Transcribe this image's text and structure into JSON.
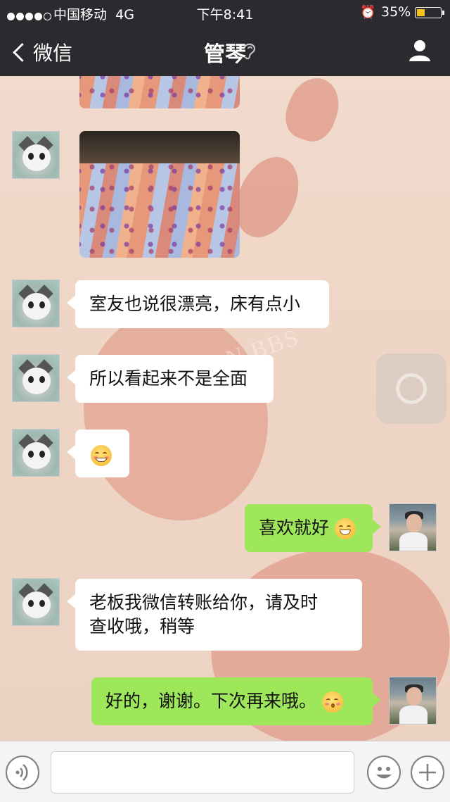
{
  "status_bar": {
    "carrier": "中国移动",
    "network": "4G",
    "time": "下午8:41",
    "battery_percent": "35%",
    "battery_level": 0.35,
    "icons": [
      "signal-dots-icon",
      "alarm-icon",
      "battery-icon"
    ]
  },
  "nav": {
    "back_label": "微信",
    "title": "管琴",
    "icons": [
      "chevron-left-icon",
      "earpiece-icon",
      "person-icon"
    ]
  },
  "messages": [
    {
      "id": "m1",
      "from": "contact",
      "type": "image",
      "content": "quilt photo (partial)"
    },
    {
      "id": "m2",
      "from": "contact",
      "type": "image",
      "content": "quilt photo"
    },
    {
      "id": "m3",
      "from": "contact",
      "type": "text",
      "text": "室友也说很漂亮，床有点小"
    },
    {
      "id": "m4",
      "from": "contact",
      "type": "text",
      "text": "所以看起来不是全面"
    },
    {
      "id": "m5",
      "from": "contact",
      "type": "emoji",
      "emoji": "blushing-smile-emoji"
    },
    {
      "id": "m6",
      "from": "me",
      "type": "text",
      "text": "喜欢就好",
      "emoji": "grinning-emoji"
    },
    {
      "id": "m7",
      "from": "contact",
      "type": "text",
      "text": "老板我微信转账给你，请及时",
      "text2": "查收哦，稍等"
    },
    {
      "id": "m8",
      "from": "me",
      "type": "text",
      "text": "好的，谢谢。下次再来哦。",
      "emoji": "kissing-emoji"
    }
  ],
  "watermark": "KUNSHAN BBS",
  "input_bar": {
    "icons": [
      "voice-icon",
      "emoji-icon",
      "plus-icon"
    ],
    "value": ""
  },
  "colors": {
    "bar_bg": "#2b2a2f",
    "my_bubble": "#9ee65a",
    "their_bubble": "#ffffff",
    "battery_fill": "#f5c518"
  }
}
